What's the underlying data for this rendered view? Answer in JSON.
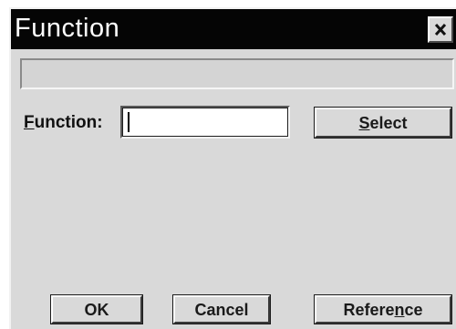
{
  "window": {
    "title": "Function"
  },
  "status_field": {
    "value": ""
  },
  "function_field": {
    "label_mnemonic": "F",
    "label_rest": "unction:",
    "value": ""
  },
  "buttons": {
    "select": {
      "mnemonic": "S",
      "rest": "elect"
    },
    "ok": {
      "label": "OK"
    },
    "cancel": {
      "label": "Cancel"
    },
    "reference": {
      "before": "Refere",
      "mnemonic": "n",
      "after": "ce"
    }
  },
  "icons": {
    "close": "close-icon"
  },
  "colors": {
    "titlebar": "#050505",
    "dialog_face": "#d9d9d9",
    "title_text": "#ffffff"
  }
}
